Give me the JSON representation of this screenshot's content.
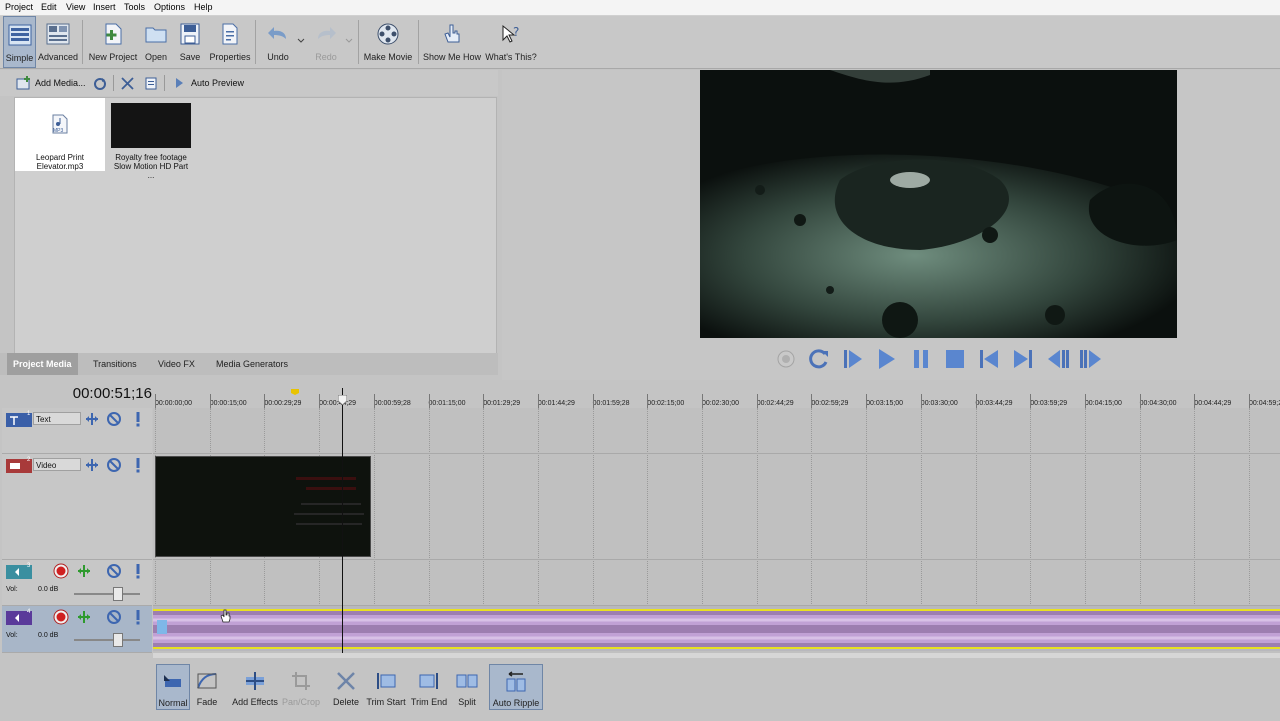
{
  "menu": [
    "Project",
    "Edit",
    "View",
    "Insert",
    "Tools",
    "Options",
    "Help"
  ],
  "toolbar": {
    "simple": "Simple",
    "advanced": "Advanced",
    "new_project": "New Project",
    "open": "Open",
    "save": "Save",
    "properties": "Properties",
    "undo": "Undo",
    "redo": "Redo",
    "make_movie": "Make Movie",
    "show_me_how": "Show Me How",
    "whats_this": "What's This?"
  },
  "media_toolbar": {
    "add_media": "Add Media...",
    "auto_preview": "Auto Preview"
  },
  "media_items": [
    {
      "name_line1": "Leopard Print",
      "name_line2": "Elevator.mp3",
      "icon": "audio-file-icon",
      "badge": "MP3"
    },
    {
      "name_line1": "Royalty free footage",
      "name_line2": "Slow Motion HD Part ...",
      "icon": "video-thumbnail"
    }
  ],
  "tabs": [
    "Project Media",
    "Transitions",
    "Video FX",
    "Media Generators"
  ],
  "active_tab": "Project Media",
  "timecode": "00:00:51;16",
  "ruler_ticks": [
    "00:00:00;00",
    "00:00:15;00",
    "00:00:29;29",
    "00:00:44;29",
    "00:00:59;28",
    "00:01:15;00",
    "00:01:29;29",
    "00:01:44;29",
    "00:01:59;28",
    "00:02:15;00",
    "00:02:30;00",
    "00:02:44;29",
    "00:02:59;29",
    "00:03:15;00",
    "00:03:30;00",
    "00:03:44;29",
    "00:03:59;29",
    "00:04:15;00",
    "00:04:30;00",
    "00:04:44;29",
    "00:04:59;2"
  ],
  "tracks": {
    "text_label": "Text",
    "text_number": "1",
    "video_label": "Video",
    "video_number": "2",
    "audio3_number": "3",
    "audio4_number": "4",
    "vol_label": "Vol:",
    "audio3_vol": "0.0 dB",
    "audio4_vol": "0.0 dB",
    "audio3_level": 0.65,
    "audio4_level": 0.65
  },
  "edit_tools": {
    "normal": "Normal",
    "fade": "Fade",
    "add_effects": "Add Effects",
    "pan_crop": "Pan/Crop",
    "delete": "Delete",
    "trim_start": "Trim Start",
    "trim_end": "Trim End",
    "split": "Split",
    "auto_ripple": "Auto Ripple"
  },
  "colors": {
    "accent_selected": "#a9b8cc",
    "audio_waveform": "#b48ec8",
    "audio_border": "#e8e020",
    "text_track_icon": "#3a5fa8",
    "video_track_icon": "#a83a3a",
    "audio_track_icon": "#3a8fa0"
  }
}
